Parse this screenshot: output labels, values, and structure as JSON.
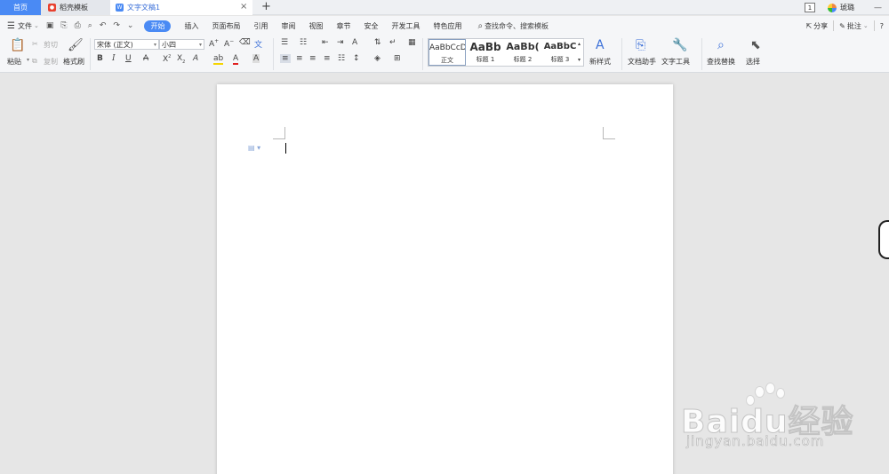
{
  "tabs": {
    "home": "首页",
    "template": "稻壳模板",
    "document": "文字文稿1",
    "close": "×",
    "add": "+"
  },
  "titlebar_right": {
    "window_count": "1",
    "user": "琥璐",
    "minimize": "—"
  },
  "menu": {
    "file": "文件",
    "items": [
      "开始",
      "插入",
      "页面布局",
      "引用",
      "审阅",
      "视图",
      "章节",
      "安全",
      "开发工具",
      "特色应用"
    ],
    "active_index": 0,
    "search_placeholder": "查找命令、搜索模板",
    "share": "分享",
    "comment": "批注",
    "help": "?"
  },
  "ribbon": {
    "paste": "粘贴",
    "cut": "剪切",
    "copy": "复制",
    "format_painter": "格式刷",
    "font_name": "宋体 (正文)",
    "font_size": "小四",
    "styles": [
      {
        "preview": "AaBbCcD",
        "label": "正文"
      },
      {
        "preview": "AaBb",
        "label": "标题 1"
      },
      {
        "preview": "AaBb(",
        "label": "标题 2"
      },
      {
        "preview": "AaBbC",
        "label": "标题 3"
      }
    ],
    "new_style": "新样式",
    "doc_assistant": "文档助手",
    "text_tools": "文字工具",
    "find_replace": "查找替换",
    "select": "选择"
  },
  "watermark": {
    "brand": "Baidu",
    "brand_cn": "经验",
    "url": "jingyan.baidu.com"
  },
  "colors": {
    "accent": "#4a8af4",
    "ribbon_bg": "#f5f6f8",
    "workspace_bg": "#e6e6e6"
  }
}
